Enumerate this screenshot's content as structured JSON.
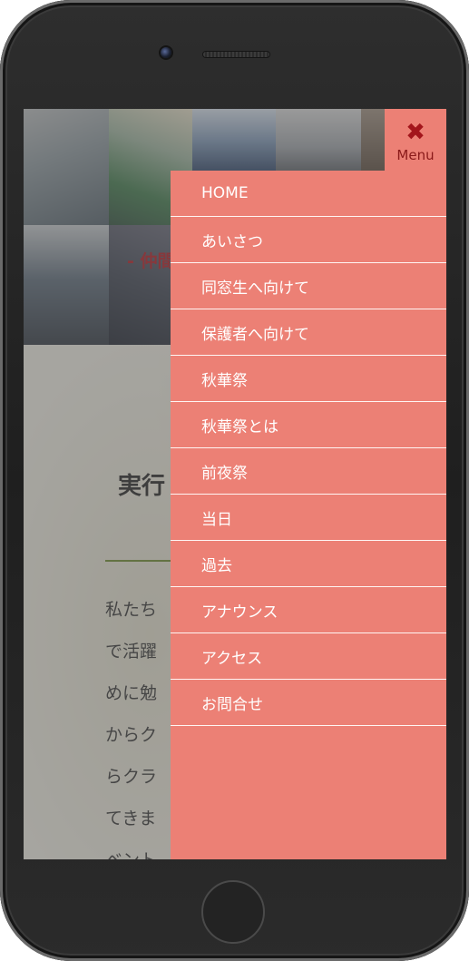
{
  "hero": {
    "subtitle": "- 仲間"
  },
  "page": {
    "title": "実行",
    "paragraph_lines": [
      "私たち",
      "で活躍",
      "めに勉",
      "からク",
      "らクラ",
      "てきま",
      "ベント"
    ]
  },
  "menu": {
    "toggle_icon": "close-icon",
    "toggle_label": "Menu",
    "items": [
      {
        "label": "HOME"
      },
      {
        "label": "あいさつ"
      },
      {
        "label": "同窓生へ向けて"
      },
      {
        "label": "保護者へ向けて"
      },
      {
        "label": "秋華祭"
      },
      {
        "label": "秋華祭とは"
      },
      {
        "label": "前夜祭"
      },
      {
        "label": "当日"
      },
      {
        "label": "過去"
      },
      {
        "label": "アナウンス"
      },
      {
        "label": "アクセス"
      },
      {
        "label": "お問合せ"
      }
    ]
  },
  "colors": {
    "menu_bg": "#ec8075",
    "menu_text": "#ffffff",
    "close_icon": "#a3151b",
    "hero_text": "#b5171f",
    "title_rule": "#6c8a2c"
  }
}
